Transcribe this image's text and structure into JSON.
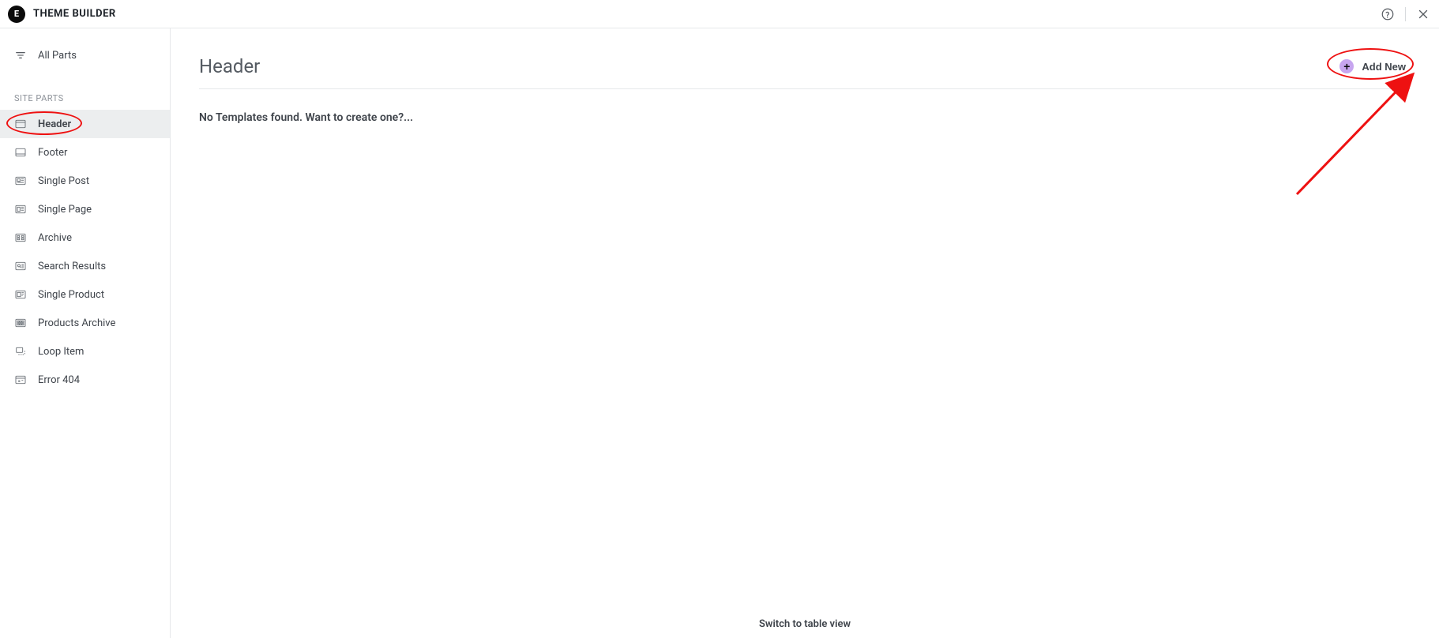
{
  "topbar": {
    "title": "THEME BUILDER"
  },
  "sidebar": {
    "all_parts": "All Parts",
    "section_label": "SITE PARTS",
    "items": [
      {
        "label": "Header",
        "active": true
      },
      {
        "label": "Footer",
        "active": false
      },
      {
        "label": "Single Post",
        "active": false
      },
      {
        "label": "Single Page",
        "active": false
      },
      {
        "label": "Archive",
        "active": false
      },
      {
        "label": "Search Results",
        "active": false
      },
      {
        "label": "Single Product",
        "active": false
      },
      {
        "label": "Products Archive",
        "active": false
      },
      {
        "label": "Loop Item",
        "active": false
      },
      {
        "label": "Error 404",
        "active": false
      }
    ]
  },
  "main": {
    "title": "Header",
    "add_new_label": "Add New",
    "empty_msg": "No Templates found. Want to create one?...",
    "bottom_link": "Switch to table view"
  }
}
